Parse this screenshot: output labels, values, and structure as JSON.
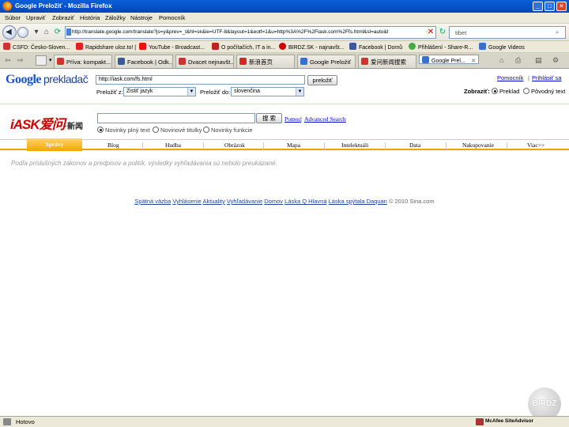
{
  "window": {
    "title": "Google Preložiť - Mozilla Firefox"
  },
  "menu": [
    "Súbor",
    "Upraviť",
    "Zobraziť",
    "História",
    "Záložky",
    "Nástroje",
    "Pomocník"
  ],
  "nav": {
    "url": "http://translate.google.com/translate?js=y&prev=_t&hl=sk&ie=UTF-8&layout=1&eotf=1&u=http%3A%2F%2Fiask.com%2Ffs.html&sl=auto&tl=sk",
    "search_value": "tibet"
  },
  "bookmarks": [
    "CSFD: Česko-Sloven...",
    "Rapidshare uloz.to! |",
    "YouTube - Broadcast...",
    "O počítačích, IT a in...",
    "BIRDZ.SK - najnavšt...",
    "Facebook | Domů",
    "Přihlášení - Share-R...",
    "Google Videos"
  ],
  "tabs": [
    "Pŕíva: kompakt...",
    "Facebook | Odk...",
    "Dvacet nejnavšt...",
    "新浪首页",
    "Google Preložiť",
    "爱问新闻搜索",
    "Google Prel..."
  ],
  "google": {
    "logo_brand": "Google",
    "logo_sub": "prekladač",
    "url_value": "http://iask.com/fs.html",
    "translate_button": "preložiť",
    "from_label": "Preložiť z:",
    "from_value": "Zistiť jazyk",
    "to_label": "Preložiť do:",
    "to_value": "slovenčina",
    "help_link": "Pomocník",
    "login_link": "Prihlásiť sa",
    "view_label": "Zobraziť:",
    "view_translation": "Preklad",
    "view_original": "Pôvodný text"
  },
  "iask": {
    "logo": "iASK",
    "logo_suffix": "爱问",
    "logo_news": "·新闻",
    "search_button": "搜 索",
    "help_link": "Pomoc",
    "advanced_link": "Advanced Search",
    "radio_fulltext": "Novinky plný text",
    "radio_titles": "Novinové titulky",
    "radio_function": "Novinky funkcie",
    "nav": [
      "Správy",
      "Blog",
      "Hudba",
      "Obrázok",
      "Mapa",
      "Intelektuáli",
      "Data",
      "Nakupovanie",
      "Viac>>"
    ],
    "notice": "Podľa príslušných zákonov a predpisov a politík, výsledky vyhľadávania sú nebolo preukázané.",
    "footer_links": [
      "Spätná väzba",
      "Vyhlásenie",
      "Aktuality",
      "Vyhľadávanie",
      "Domov",
      "Láska Q Hlavná",
      "Láska spýtala Daquan"
    ],
    "footer_copy": "© 2010 Sina.com"
  },
  "status": {
    "text": "Hotovo",
    "addon": "McAfee SiteAdvisor"
  },
  "watermark": "BIRDZ",
  "colors": {
    "titlebar": "#0a5fd8",
    "accent": "#f4a500",
    "link": "#0000cc"
  }
}
